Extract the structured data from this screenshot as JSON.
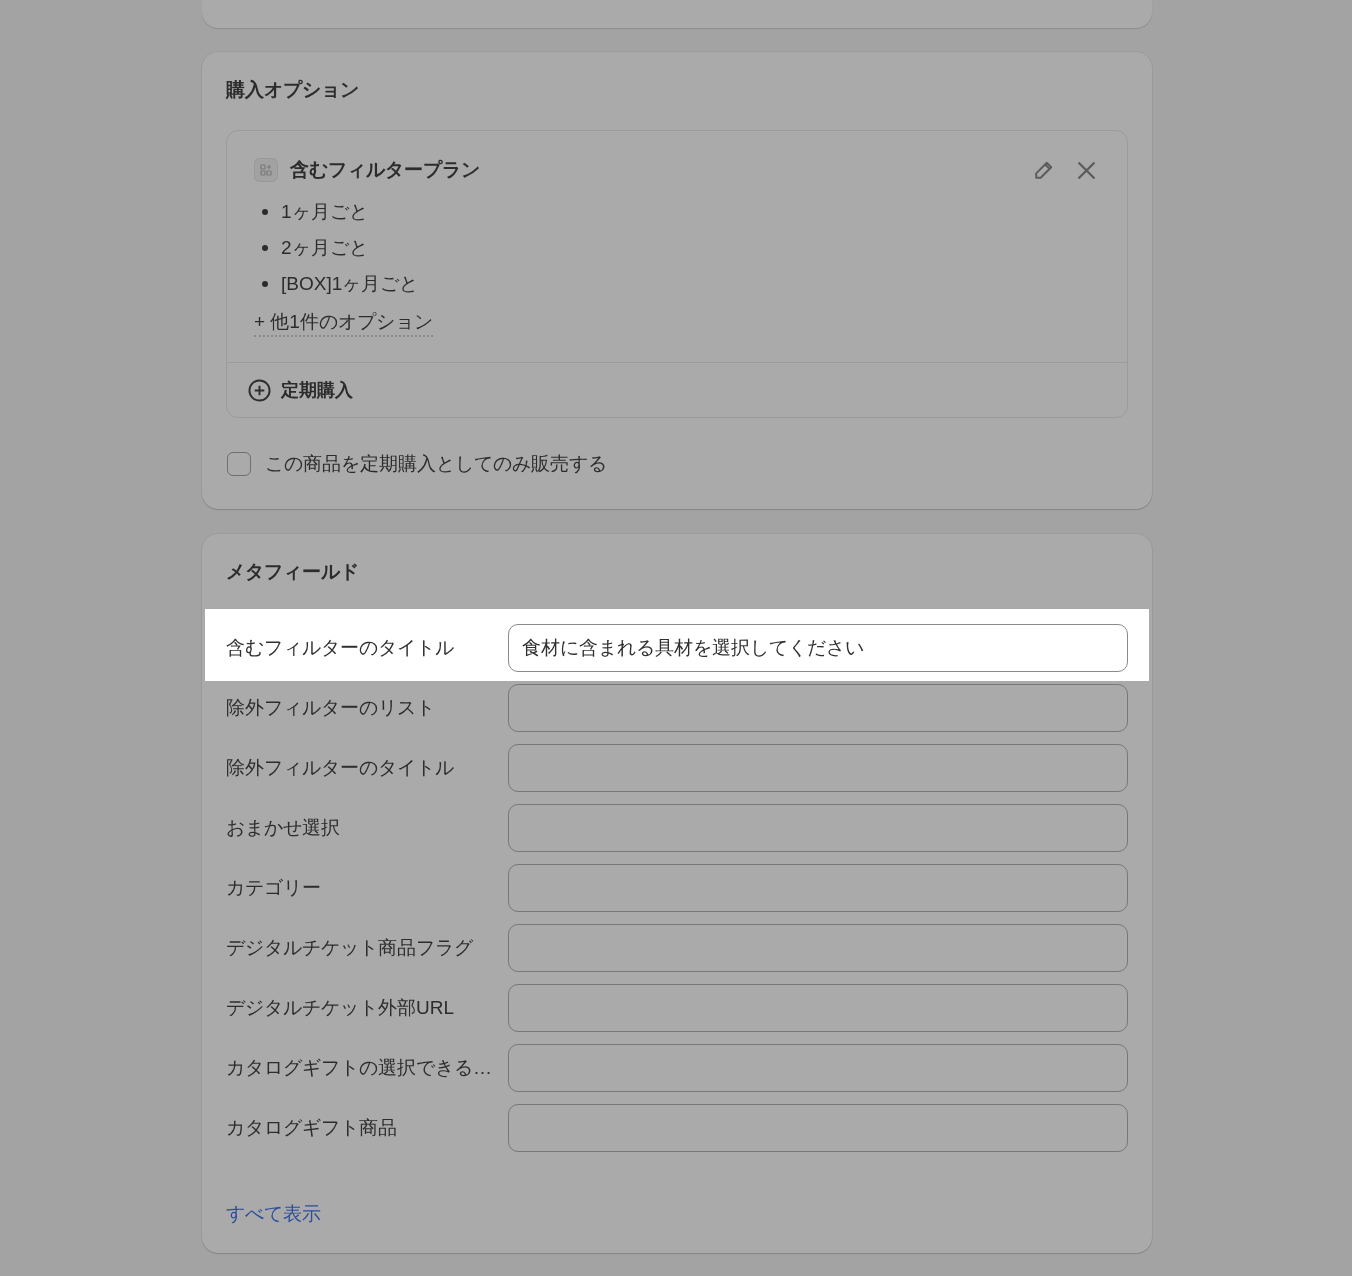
{
  "purchase_options": {
    "title": "購入オプション",
    "plan": {
      "title": "含むフィルタープラン",
      "options": [
        "1ヶ月ごと",
        "2ヶ月ごと",
        "[BOX]1ヶ月ごと"
      ],
      "more_link": "+ 他1件のオプション"
    },
    "add_button": "定期購入",
    "subscription_only": {
      "label": "この商品を定期購入としてのみ販売する",
      "checked": false
    }
  },
  "metafields": {
    "title": "メタフィールド",
    "fields": [
      {
        "label": "含むフィルターのタイトル",
        "value": "食材に含まれる具材を選択してください",
        "highlighted": true
      },
      {
        "label": "除外フィルターのリスト",
        "highlighted": false
      },
      {
        "label": "除外フィルターのタイトル",
        "highlighted": false
      },
      {
        "label": "おまかせ選択",
        "highlighted": false
      },
      {
        "label": "カテゴリー",
        "highlighted": false
      },
      {
        "label": "デジタルチケット商品フラグ",
        "highlighted": false
      },
      {
        "label": "デジタルチケット外部URL",
        "highlighted": false
      },
      {
        "label": "カタログギフトの選択できる…",
        "highlighted": false
      },
      {
        "label": "カタログギフト商品",
        "highlighted": false
      }
    ],
    "show_all_link": "すべて表示"
  }
}
